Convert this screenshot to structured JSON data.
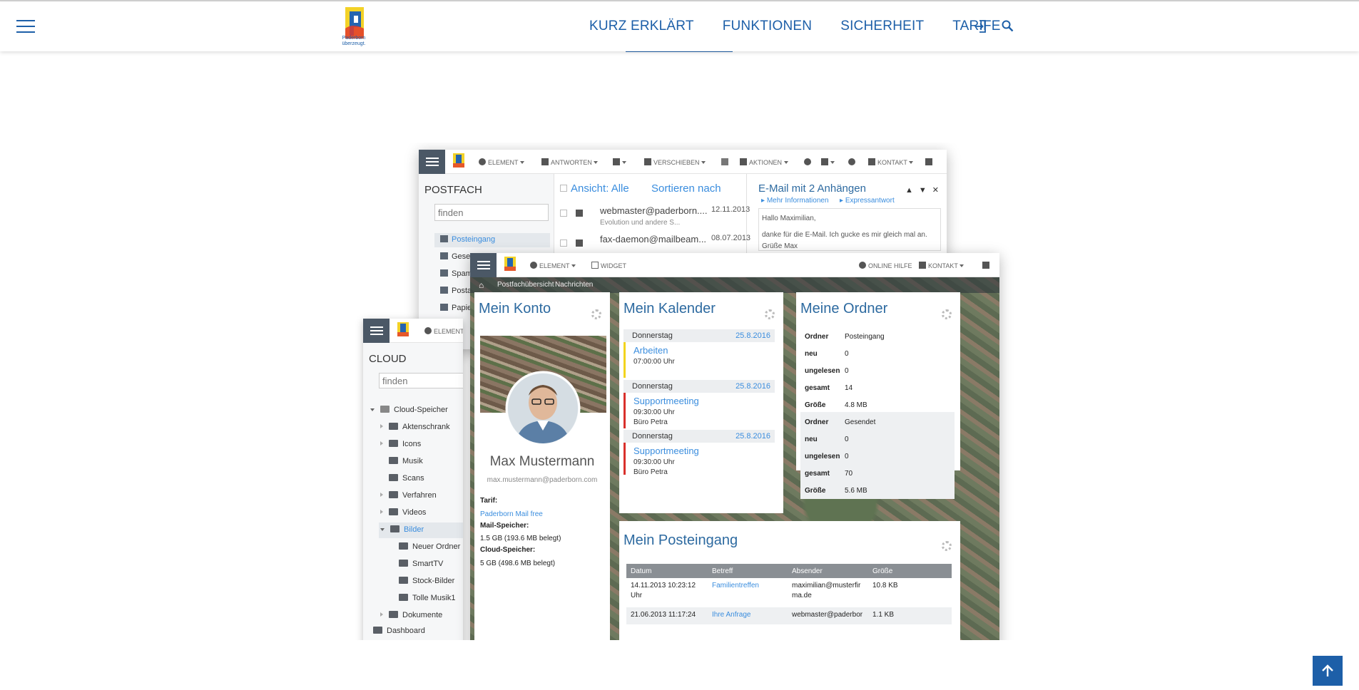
{
  "nav": {
    "logo_text_line1": "Paderborn",
    "logo_text_line2": "überzeugt.",
    "items": [
      "KURZ ERKLÄRT",
      "FUNKTIONEN",
      "SICHERHEIT",
      "TARIFE"
    ]
  },
  "mail_window": {
    "toolbar": [
      "ELEMENT",
      "ANTWORTEN",
      "VERSCHIEBEN",
      "AKTIONEN",
      "KONTAKT"
    ],
    "title": "POSTFACH",
    "search_placeholder": "finden",
    "folders": [
      "Posteingang",
      "Gesen",
      "Spam",
      "Posta",
      "Papie"
    ],
    "list_view_label": "Ansicht: Alle",
    "list_sort_label": "Sortieren nach",
    "messages": [
      {
        "from": "webmaster@paderborn....",
        "date": "12.11.2013",
        "preview": "Evolution und andere S..."
      },
      {
        "from": "fax-daemon@mailbeam...",
        "date": "08.07.2013",
        "preview": ""
      }
    ],
    "preview_title": "E-Mail mit 2 Anhängen",
    "preview_more": "Mehr Informationen",
    "preview_express": "Expressantwort",
    "preview_body_1": "Hallo Maximilian,",
    "preview_body_2": "danke für die E-Mail. Ich gucke es mir gleich mal an.",
    "preview_body_3": "Grüße Max"
  },
  "cloud_window": {
    "toolbar": [
      "ELEMENT"
    ],
    "title": "CLOUD",
    "search_placeholder": "finden",
    "root": "Cloud-Speicher",
    "items": [
      "Aktenschrank",
      "Icons",
      "Musik",
      "Scans",
      "Verfahren",
      "Videos",
      "Bilder",
      "Neuer Ordner",
      "SmartTV",
      "Stock-Bilder",
      "Tolle Musik1",
      "Dokumente",
      "Dashboard"
    ]
  },
  "dashboard_window": {
    "toolbar": [
      "ELEMENT",
      "WIDGET",
      "ONLINE HILFE",
      "KONTAKT"
    ],
    "breadcrumb": [
      "Postfachübersicht",
      "Nachrichten"
    ],
    "account": {
      "title": "Mein Konto",
      "name": "Max Mustermann",
      "email": "max.mustermann@paderborn.com",
      "tarif_label": "Tarif:",
      "tarif_value": "Paderborn Mail free",
      "mail_label": "Mail-Speicher:",
      "mail_value": "1.5 GB (193.6 MB belegt)",
      "cloud_label": "Cloud-Speicher:",
      "cloud_value": "5 GB (498.6 MB belegt)"
    },
    "calendar": {
      "title": "Mein Kalender",
      "entries": [
        {
          "day": "Donnerstag",
          "date": "25.8.2016",
          "title": "Arbeiten",
          "time": "07:00:00 Uhr",
          "place": "",
          "color": "#f2d41e"
        },
        {
          "day": "Donnerstag",
          "date": "25.8.2016",
          "title": "Supportmeeting",
          "time": "09:30:00 Uhr",
          "place": "Büro Petra",
          "color": "#d9302c"
        },
        {
          "day": "Donnerstag",
          "date": "25.8.2016",
          "title": "Supportmeeting",
          "time": "09:30:00 Uhr",
          "place": "Büro Petra",
          "color": "#d9302c"
        }
      ]
    },
    "folders": {
      "title": "Meine Ordner",
      "labels": [
        "Ordner",
        "neu",
        "ungelesen",
        "gesamt",
        "Größe"
      ],
      "groups": [
        {
          "values": [
            "Posteingang",
            "0",
            "0",
            "14",
            "4.8 MB"
          ]
        },
        {
          "values": [
            "Gesendet",
            "0",
            "0",
            "70",
            "5.6 MB"
          ]
        }
      ]
    },
    "inbox": {
      "title": "Mein Posteingang",
      "columns": [
        "Datum",
        "Betreff",
        "Absender",
        "Größe"
      ],
      "rows": [
        {
          "date_1": "14.11.2013 10:23:12",
          "date_2": "Uhr",
          "subject": "Familientreffen",
          "sender_1": "maximilian@musterfir",
          "sender_2": "ma.de",
          "size": "10.8 KB"
        },
        {
          "date_1": "21.06.2013 11:17:24",
          "date_2": "",
          "subject": "Ihre Anfrage",
          "sender_1": "webmaster@paderbor",
          "sender_2": "",
          "size": "1.1 KB"
        }
      ]
    }
  }
}
